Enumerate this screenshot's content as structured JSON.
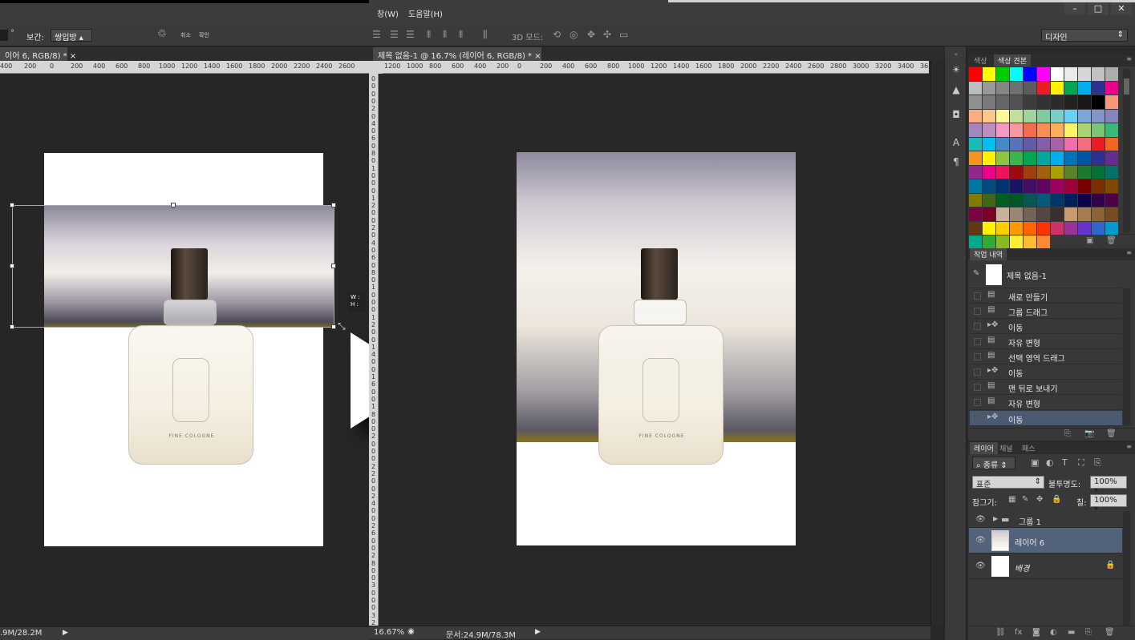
{
  "left_window": {
    "options": {
      "angle_suffix": "°",
      "interp_label": "보간:",
      "interp_value": "쌍입방",
      "cancel_label": "취소",
      "commit_label": "확인"
    },
    "doc_tab": "이어 6, RGB/8) *",
    "ruler_ticks": [
      "400",
      "200",
      "0",
      "200",
      "400",
      "600",
      "800",
      "1000",
      "1200",
      "1400",
      "1600",
      "1800",
      "2000",
      "2200",
      "2400",
      "2600"
    ],
    "transform_box": {
      "w_label": "W :",
      "h_label": "H :"
    },
    "bottle_label": "FINE COLOGNE",
    "status": {
      "doc_size": ".9M/28.2M"
    }
  },
  "right_window": {
    "menu": [
      "창(W)",
      "도움말(H)"
    ],
    "window_controls": [
      "–",
      "□",
      "✕"
    ],
    "options": {
      "mode_3d_label": "3D 모드:"
    },
    "workspace": "디자인",
    "doc_tab": "제목 없음-1 @ 16.7% (레이어 6, RGB/8) *",
    "ruler_ticks": [
      "1200",
      "1000",
      "800",
      "600",
      "400",
      "200",
      "0",
      "200",
      "400",
      "600",
      "800",
      "1000",
      "1200",
      "1400",
      "1600",
      "1800",
      "2000",
      "2200",
      "2400",
      "2600",
      "2800",
      "3000",
      "3200",
      "3400",
      "36"
    ],
    "vruler_digits": [
      "0",
      "0",
      "0",
      "0",
      "2",
      "0",
      "4",
      "0",
      "6",
      "0",
      "8",
      "0",
      "1",
      "0",
      "0",
      "0",
      "1",
      "2",
      "0",
      "0",
      "2",
      "0",
      "4",
      "0",
      "6",
      "0",
      "8",
      "0",
      "1",
      "0",
      "0",
      "0",
      "1",
      "2",
      "0",
      "0",
      "1",
      "4",
      "0",
      "0",
      "1",
      "6",
      "0",
      "0",
      "1",
      "8",
      "0",
      "0",
      "2",
      "0",
      "0",
      "0",
      "2",
      "2",
      "0",
      "0",
      "2",
      "4",
      "0",
      "0",
      "2",
      "6",
      "0",
      "0",
      "2",
      "8",
      "0",
      "0",
      "3",
      "0",
      "0",
      "0",
      "3",
      "2"
    ],
    "bottle_label": "FINE COLOGNE",
    "status": {
      "zoom": "16.67%",
      "doc_size": "문서:24.9M/78.3M"
    }
  },
  "swatches_panel": {
    "tabs": [
      "색상",
      "색상 견본"
    ],
    "colors": [
      "#ff0000",
      "#ffff00",
      "#00cc00",
      "#00ffff",
      "#0000ff",
      "#ff00ff",
      "#ffffff",
      "#ebebeb",
      "#d6d6d6",
      "#c2c2c2",
      "#adadad",
      "#bdbdbd",
      "#999999",
      "#858585",
      "#707070",
      "#5c5c5c",
      "#ed1c24",
      "#fff200",
      "#00a651",
      "#00aeef",
      "#2e3192",
      "#ec008c",
      "#8f8f8f",
      "#7a7a7a",
      "#666666",
      "#525252",
      "#3d3d3d",
      "#333333",
      "#2b2b2b",
      "#222222",
      "#191919",
      "#000000",
      "#f7977a",
      "#f9ad81",
      "#fdc68a",
      "#fff79a",
      "#c4df9b",
      "#a3d39c",
      "#82ca9d",
      "#7bcdc8",
      "#6ecff6",
      "#7ea7d8",
      "#8493ca",
      "#8882be",
      "#a187be",
      "#bc8dbf",
      "#f49ac2",
      "#f6989d",
      "#f26c4f",
      "#f68e55",
      "#fbaf5c",
      "#fff467",
      "#acd372",
      "#7cc576",
      "#3bb878",
      "#1abbb4",
      "#00bff3",
      "#438ccb",
      "#5574b9",
      "#605ca8",
      "#855fa8",
      "#a763a8",
      "#f06ea9",
      "#f26d7d",
      "#ed1c24",
      "#f26522",
      "#f7941d",
      "#fff200",
      "#8dc73f",
      "#39b54a",
      "#00a651",
      "#00a99d",
      "#00aeef",
      "#0072bc",
      "#0054a6",
      "#2e3192",
      "#662d91",
      "#92278f",
      "#ec008c",
      "#ed145b",
      "#9e0b0f",
      "#a0410d",
      "#a3620a",
      "#aba000",
      "#598527",
      "#1a7b30",
      "#007236",
      "#00746b",
      "#0076a3",
      "#004b80",
      "#003471",
      "#1b1464",
      "#440e62",
      "#630460",
      "#9e005d",
      "#9e0039",
      "#790000",
      "#7b2e00",
      "#7d4900",
      "#827b00",
      "#406618",
      "#005e20",
      "#005826",
      "#005952",
      "#005b7f",
      "#003663",
      "#002157",
      "#0d004c",
      "#32004b",
      "#4b0049",
      "#7b0046",
      "#7a0026",
      "#c7b299",
      "#998675",
      "#736357",
      "#534741",
      "#37302d",
      "#c69c6d",
      "#a67c52",
      "#8c6239",
      "#754c24",
      "#603913",
      "#fff200",
      "#ffcc00",
      "#ff9900",
      "#ff6600",
      "#ff3300",
      "#cc3366",
      "#993399",
      "#6633cc",
      "#3366cc",
      "#0099cc",
      "#00aa88",
      "#33aa33",
      "#88bb22",
      "#ffee33",
      "#ffbb33",
      "#ff8833"
    ]
  },
  "history_panel": {
    "tab": "작업 내역",
    "snapshot": "제목 없음-1",
    "items": [
      "새로 만들기",
      "그룹 드래그",
      "이동",
      "자유 변형",
      "선택 영역 드래그",
      "이동",
      "맨 뒤로 보내기",
      "자유 변형",
      "이동"
    ]
  },
  "layers_panel": {
    "tabs": [
      "레이어",
      "채널",
      "패스"
    ],
    "filter": "종류",
    "blend_mode": "표준",
    "opacity_label": "불투명도:",
    "opacity": "100%",
    "lock_label": "잠그기:",
    "fill_label": "칠:",
    "fill": "100%",
    "layers": [
      "그룹 1",
      "레이어 6",
      "배경"
    ]
  }
}
